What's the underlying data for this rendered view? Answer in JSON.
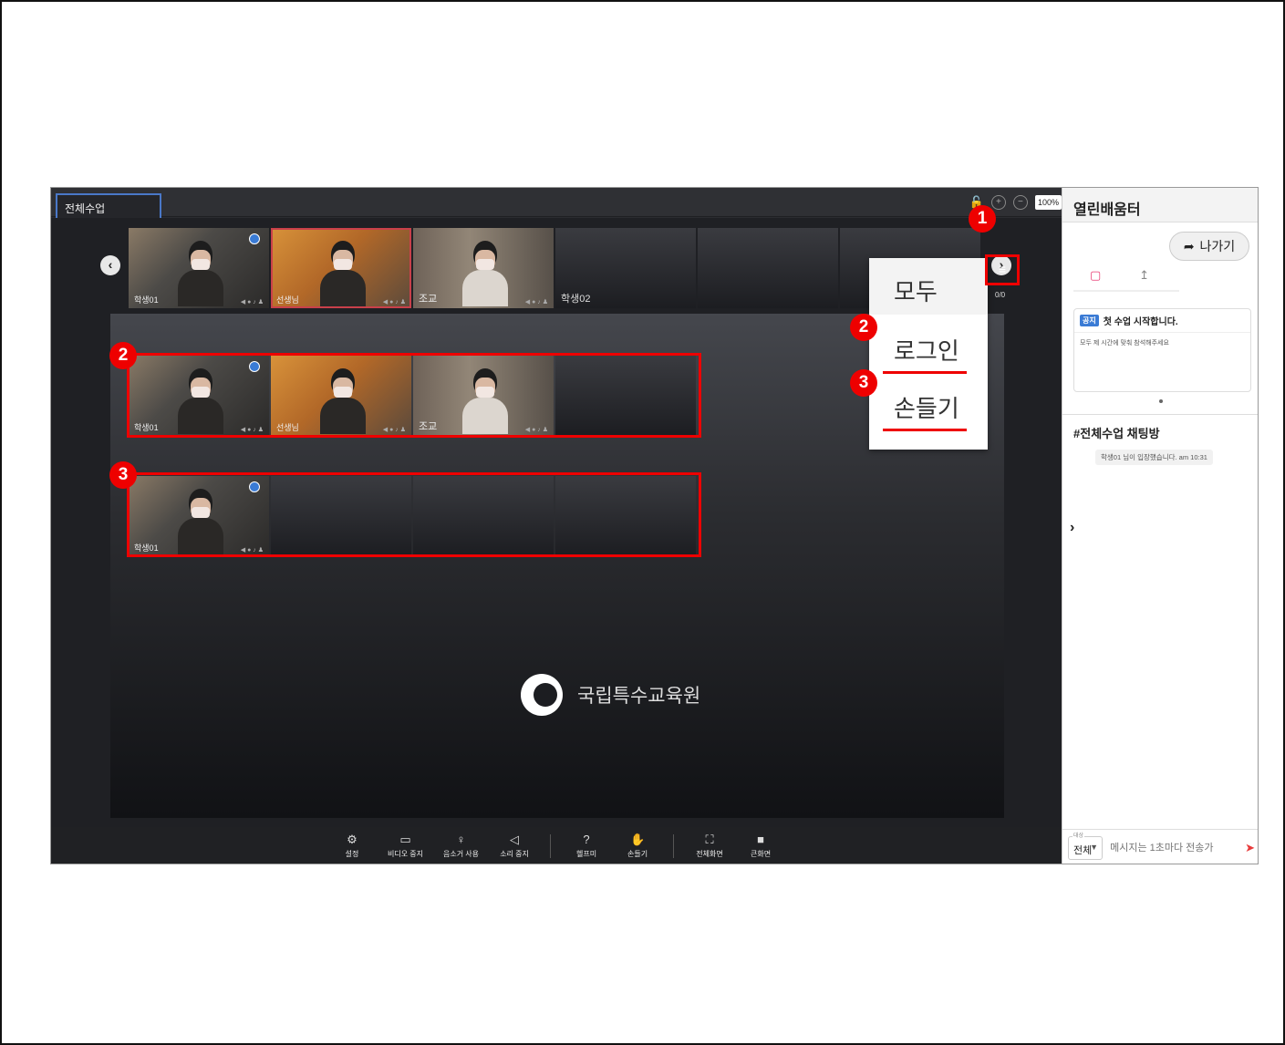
{
  "tabs": {
    "active": "전체수업"
  },
  "zoom": {
    "percent": "100%"
  },
  "thumbnails_top": [
    {
      "label": "학생01"
    },
    {
      "label": "선생님"
    },
    {
      "label": "조교"
    },
    {
      "label": "학생02"
    }
  ],
  "thumbnails_login": [
    {
      "label": "학생01"
    },
    {
      "label": "선생님"
    },
    {
      "label": "조교"
    }
  ],
  "thumbnails_hand": [
    {
      "label": "학생01"
    }
  ],
  "pager": {
    "count": "0/0"
  },
  "filter_menu": {
    "all": "모두",
    "login": "로그인",
    "raise_hand": "손들기"
  },
  "callouts": {
    "one": "1",
    "two": "2",
    "three": "3"
  },
  "main_stage": {
    "org_name": "국립특수교육원"
  },
  "toolbar": {
    "settings": "설정",
    "video_stop": "비디오 중지",
    "mic_use": "음소거 사용",
    "sound_stop": "소리 중지",
    "help": "헬프미",
    "raise_hand": "손들기",
    "fullscreen": "전체화면",
    "big_screen": "큰화면"
  },
  "sidebar": {
    "title": "열린배움터",
    "exit_button": "나가기",
    "notice": {
      "tag": "공지",
      "title": "첫 수업 시작합니다.",
      "body": "모두 제 시간에 맞춰 참석해주세요"
    },
    "chat_room": "#전체수업 채팅방",
    "chat_message": "학생01 님이 입장했습니다. am 10:31",
    "target_caption": "대상",
    "target_value": "전체",
    "input_placeholder": "메시지는 1초마다 전송가"
  },
  "colors": {
    "highlight_red": "#ee0000",
    "accent_blue": "#3a7bd5",
    "accent_pink": "#e83a72"
  },
  "icons": [
    "filter-icon",
    "chevron-left-icon",
    "chevron-right-icon",
    "settings-icon",
    "video-icon",
    "mic-icon",
    "speaker-icon",
    "help-icon",
    "hand-icon",
    "fullscreen-icon",
    "big-screen-icon",
    "exit-icon",
    "chat-icon",
    "file-upload-icon",
    "send-icon"
  ]
}
